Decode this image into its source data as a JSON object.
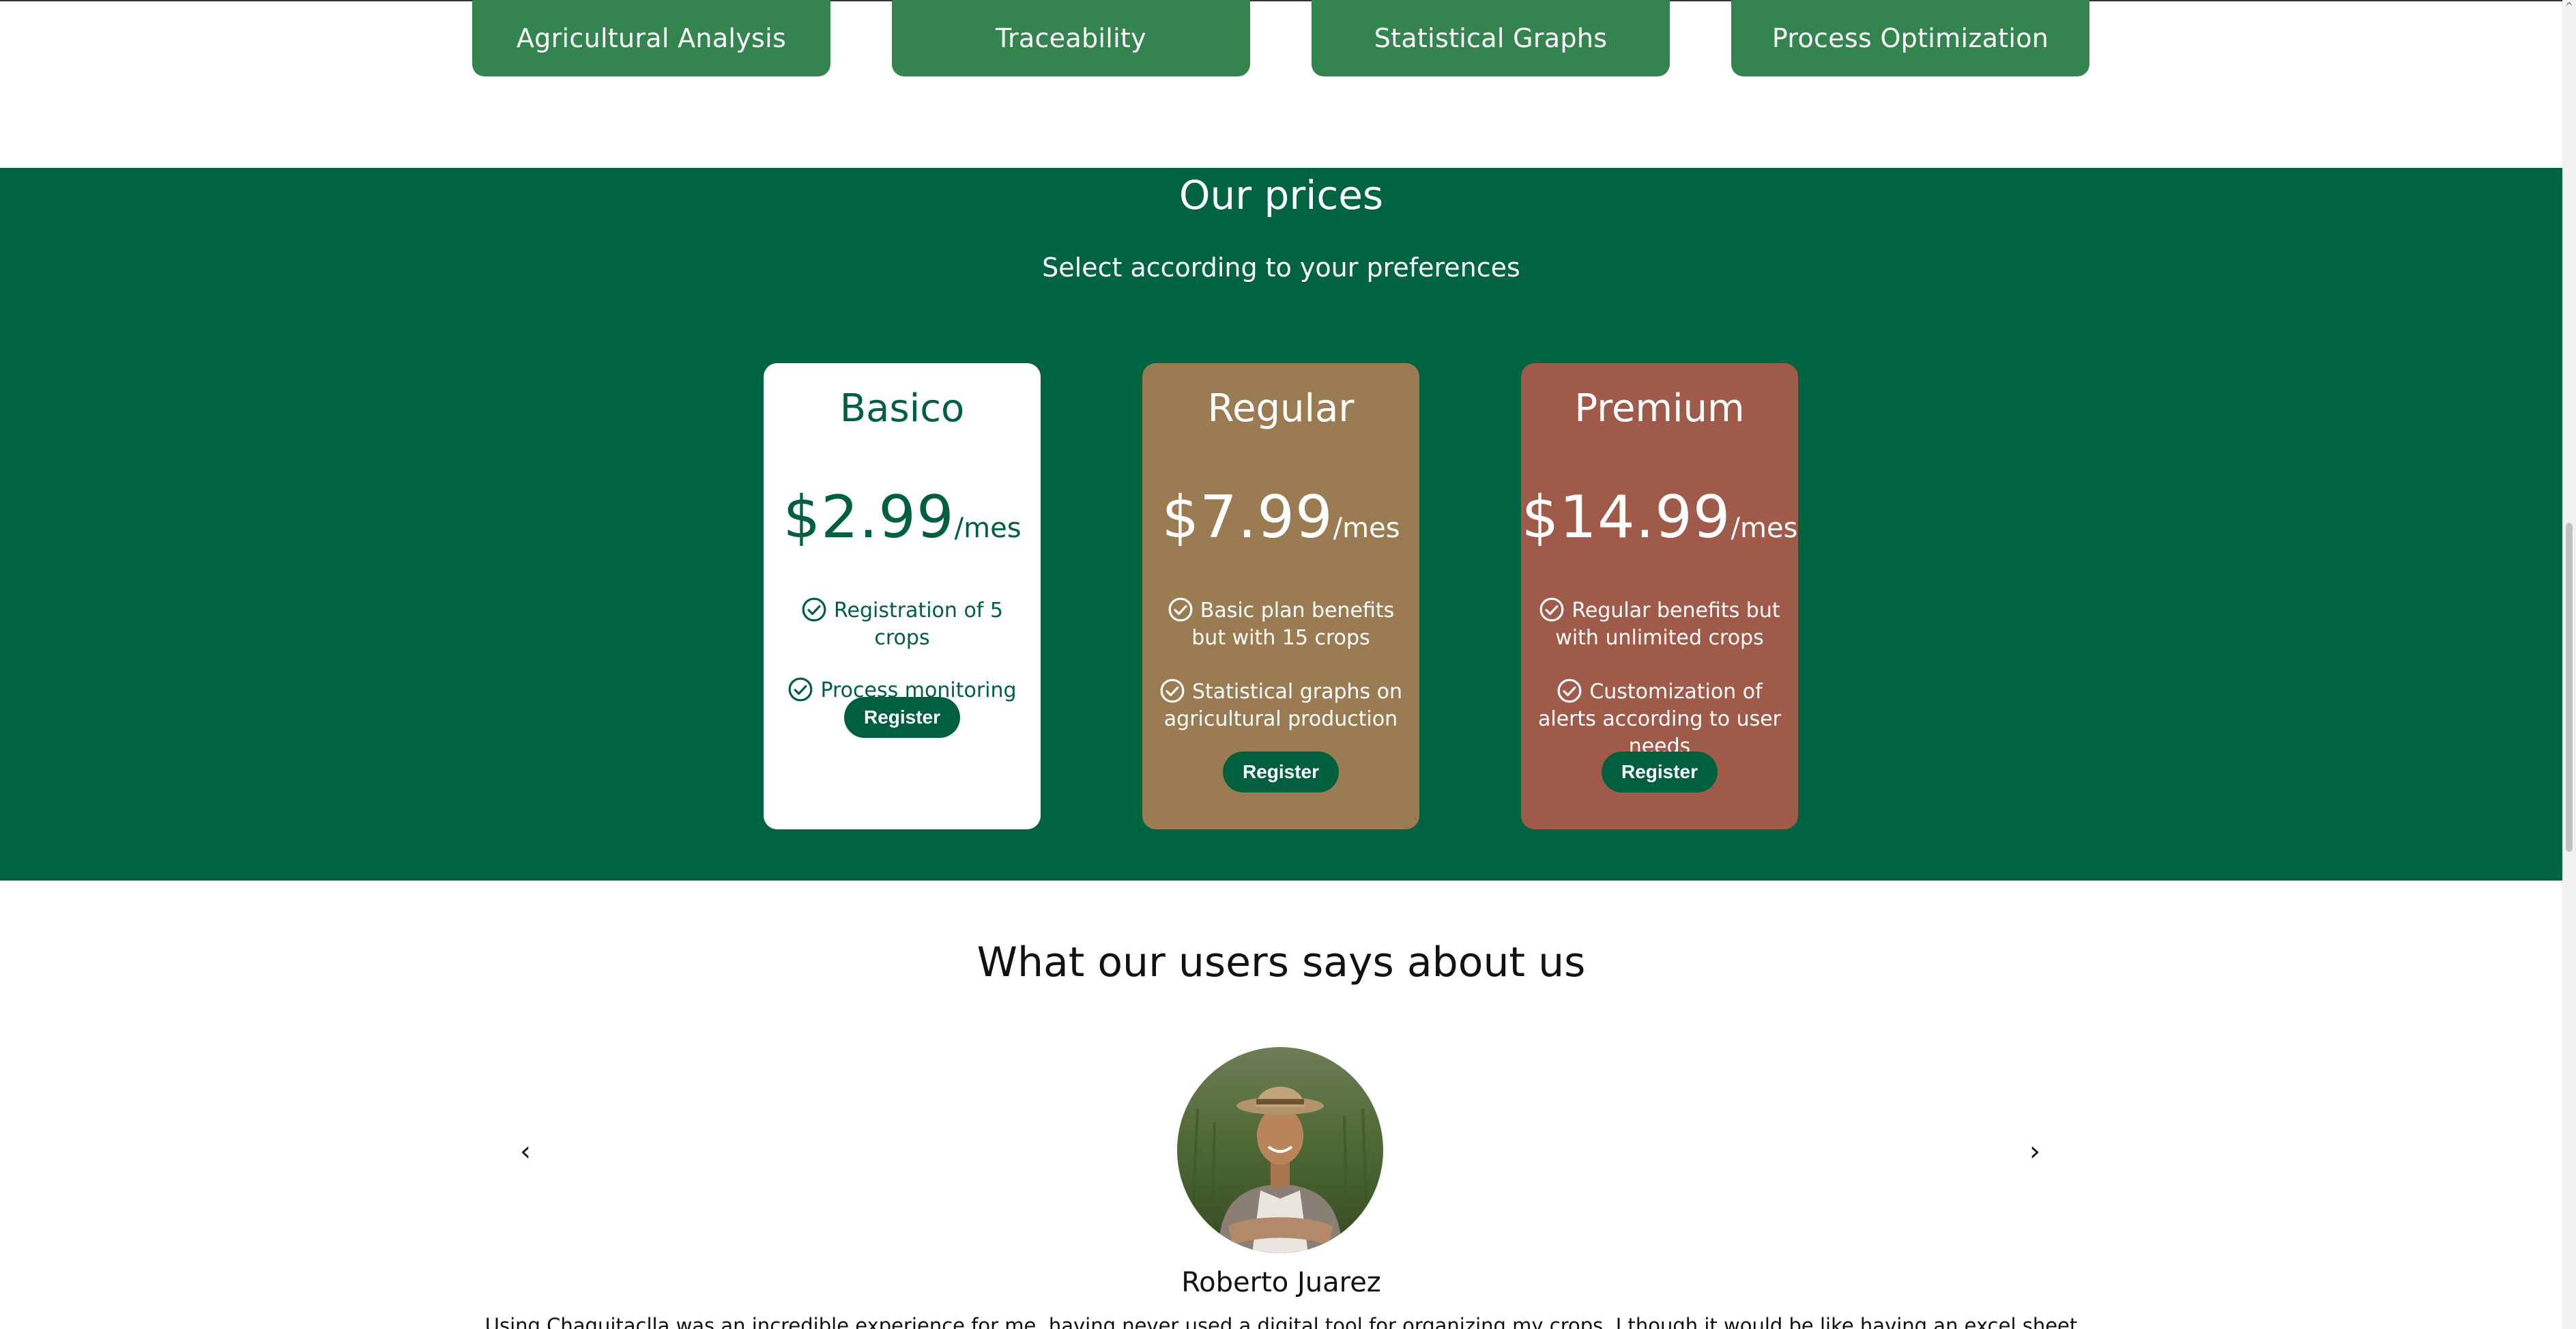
{
  "features": [
    {
      "label": "Agricultural Analysis"
    },
    {
      "label": "Traceability"
    },
    {
      "label": "Statistical Graphs"
    },
    {
      "label": "Process Optimization"
    }
  ],
  "prices": {
    "title": "Our prices",
    "subtitle": "Select according to your preferences",
    "plans": [
      {
        "name": "Basico",
        "amount": "$2.99",
        "period": "/mes",
        "features": [
          "Registration of 5 crops",
          "Process monitoring"
        ],
        "button": "Register",
        "background": "#ffffff"
      },
      {
        "name": "Regular",
        "amount": "$7.99",
        "period": "/mes",
        "features": [
          "Basic plan benefits but with 15 crops",
          "Statistical graphs on agricultural production"
        ],
        "button": "Register",
        "background": "#9b7c52"
      },
      {
        "name": "Premium",
        "amount": "$14.99",
        "period": "/mes",
        "features": [
          "Regular benefits but with unlimited crops",
          "Customization of alerts according to user needs"
        ],
        "button": "Register",
        "background": "#a05a4a"
      }
    ]
  },
  "testimonials": {
    "title": "What our users says about us",
    "prev": "‹",
    "next": "›",
    "user_name": "Roberto Juarez",
    "quote": "Using Chaquitaclla was an incredible experience for me, having never used a digital tool for organizing my crops, I though it would be like having an excel sheet"
  },
  "colors": {
    "brand_green": "#006442",
    "button_green": "#348450",
    "regular_card": "#9b7c52",
    "premium_card": "#a05a4a"
  },
  "icons": {
    "check": "check-circle-icon",
    "prev": "chevron-left-icon",
    "next": "chevron-right-icon"
  }
}
